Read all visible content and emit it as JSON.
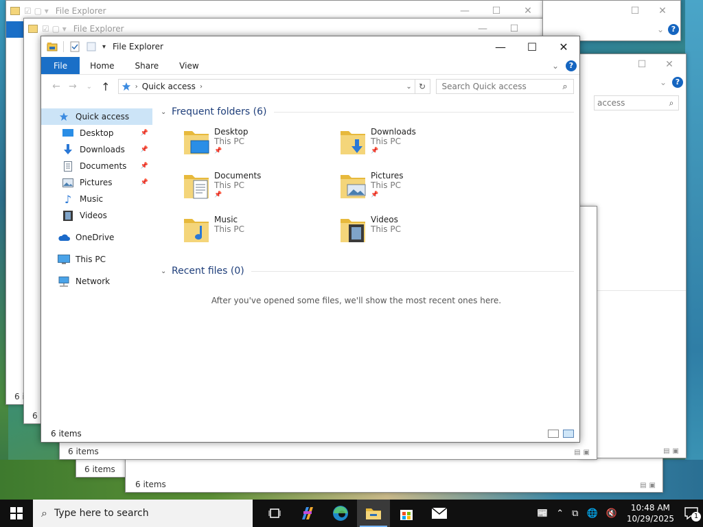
{
  "window": {
    "title": "File Explorer",
    "controls": {
      "minimize": "—",
      "maximize": "☐",
      "close": "✕"
    }
  },
  "background_windows": [
    {
      "title": "File Explorer",
      "status": "6 items"
    },
    {
      "title": "File Explorer",
      "status": "6 items"
    },
    {
      "status": "6 items"
    },
    {
      "status": "6 items"
    },
    {
      "status": "6 items",
      "search_fragment": "access"
    }
  ],
  "ribbon": {
    "tabs": [
      "File",
      "Home",
      "Share",
      "View"
    ],
    "help": "?"
  },
  "address": {
    "crumb": "Quick access",
    "search_placeholder": "Search Quick access"
  },
  "nav": {
    "quick_access": "Quick access",
    "pinned": [
      {
        "label": "Desktop",
        "pinned": true
      },
      {
        "label": "Downloads",
        "pinned": true
      },
      {
        "label": "Documents",
        "pinned": true
      },
      {
        "label": "Pictures",
        "pinned": true
      },
      {
        "label": "Music",
        "pinned": false
      },
      {
        "label": "Videos",
        "pinned": false
      }
    ],
    "onedrive": "OneDrive",
    "this_pc": "This PC",
    "network": "Network"
  },
  "content": {
    "frequent_header": "Frequent folders (6)",
    "folders": [
      {
        "name": "Desktop",
        "location": "This PC",
        "pinned": true
      },
      {
        "name": "Downloads",
        "location": "This PC",
        "pinned": true
      },
      {
        "name": "Documents",
        "location": "This PC",
        "pinned": true
      },
      {
        "name": "Pictures",
        "location": "This PC",
        "pinned": true
      },
      {
        "name": "Music",
        "location": "This PC",
        "pinned": false
      },
      {
        "name": "Videos",
        "location": "This PC",
        "pinned": false
      }
    ],
    "recent_header": "Recent files (0)",
    "recent_message": "After you've opened some files, we'll show the most recent ones here."
  },
  "status": {
    "items": "6 items"
  },
  "taskbar": {
    "search_placeholder": "Type here to search",
    "time": "10:48 AM",
    "date": "10/29/2025",
    "notification_count": "1"
  },
  "colors": {
    "accent": "#1a6fc7",
    "selection": "#cce4f7",
    "folder": "#f4d57a",
    "taskbar": "#101010"
  }
}
